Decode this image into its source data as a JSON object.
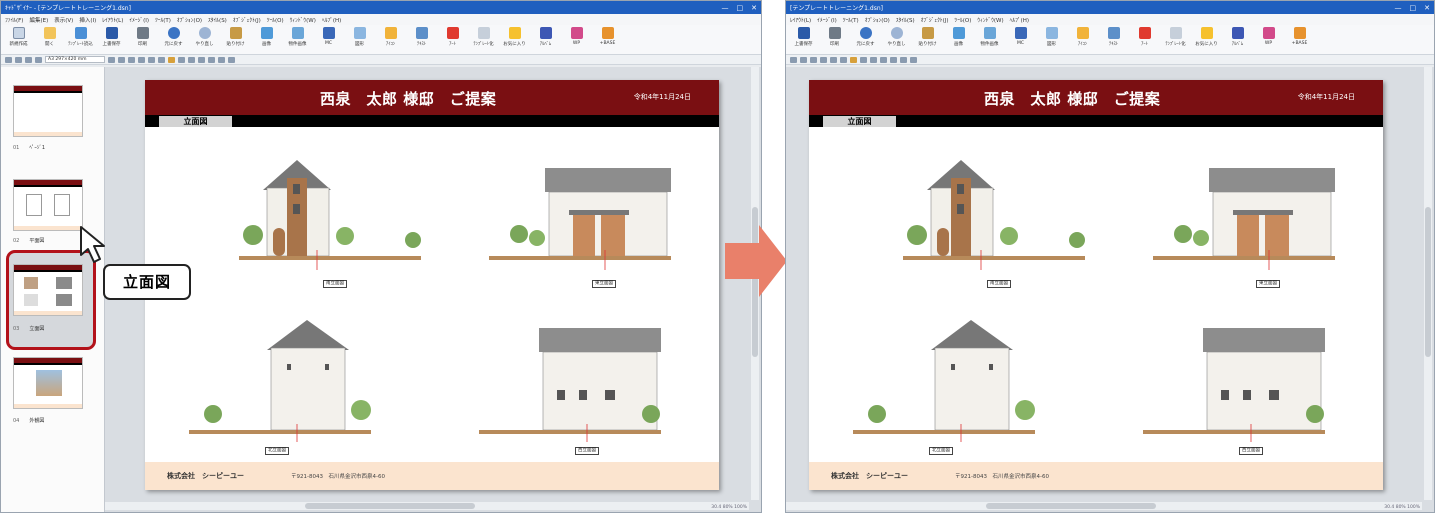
{
  "left_window": {
    "title": "ｷｬﾄﾞｻﾞｲﾅｰ - [テンプレートトレーニング1.dsn]",
    "window_controls": [
      "—",
      "□",
      "✕"
    ],
    "menu": [
      "ﾌｧｲﾙ(F)",
      "編集(E)",
      "表示(V)",
      "挿入(I)",
      "ﾚｲｱｳﾄ(L)",
      "ｲﾒｰｼﾞ(I)",
      "ﾂｰﾙ(T)",
      "ｵﾌﾟｼｮﾝ(O)",
      "ｽﾀｲﾙ(S)",
      "ｵﾌﾞｼﾞｪｸﾄ(J)",
      "ﾂｰﾙ(O)",
      "ｳｨﾝﾄﾞｳ(W)",
      "ﾍﾙﾌﾟ(H)"
    ],
    "ribbon": [
      "新規作成",
      "開く",
      "ﾃﾝﾌﾟﾚｰﾄ読込",
      "上書保存",
      "印刷",
      "元に戻す",
      "やり直し",
      "貼り付け",
      "画像",
      "物件画像",
      "MC",
      "図形",
      "ｱｲｺﾝ",
      "ﾃｷｽﾄ",
      "ｱｰﾄ",
      "ﾃﾝﾌﾟﾚｰﾄ化",
      "お気に入り",
      "ｱﾙﾊﾞﾑ",
      "WP",
      "+BASE"
    ],
    "paper_size": "A3 297×420 mm",
    "thumbnails": [
      {
        "num": "01",
        "label": "ﾍﾟｰｼﾞ1"
      },
      {
        "num": "02",
        "label": "平面図"
      },
      {
        "num": "03",
        "label": "立面図"
      },
      {
        "num": "04",
        "label": "外観図"
      }
    ],
    "callout": "立面図",
    "status": "30.4  80%  100%"
  },
  "right_window": {
    "title": "[テンプレートトレーニング1.dsn]",
    "window_controls": [
      "—",
      "□",
      "✕"
    ],
    "menu": [
      "ﾚｲｱｳﾄ(L)",
      "ｲﾒｰｼﾞ(I)",
      "ﾂｰﾙ(T)",
      "ｵﾌﾟｼｮﾝ(O)",
      "ｽﾀｲﾙ(S)",
      "ｵﾌﾞｼﾞｪｸﾄ(J)",
      "ﾂｰﾙ(O)",
      "ｳｨﾝﾄﾞｳ(W)",
      "ﾍﾙﾌﾟ(H)"
    ],
    "ribbon": [
      "上書保存",
      "印刷",
      "元に戻す",
      "やり直し",
      "貼り付け",
      "画像",
      "物件画像",
      "MC",
      "図形",
      "ｱｲｺﾝ",
      "ﾃｷｽﾄ",
      "ｱｰﾄ",
      "ﾃﾝﾌﾟﾚｰﾄ化",
      "お気に入り",
      "ｱﾙﾊﾞﾑ",
      "WP",
      "+BASE"
    ],
    "status": "30.4  80%  100%"
  },
  "page": {
    "title": "西泉　太郎 様邸　ご提案",
    "date": "令和4年11月24日",
    "section": "立面図",
    "elevations": [
      "南立面図",
      "東立面図",
      "北立面図",
      "西立面図"
    ],
    "company": "株式会社　シーピーユー",
    "address": "〒921-8043　石川県金沢市西泉4-60"
  },
  "colors": {
    "header": "#7a0f12",
    "footer": "#fbe4cf",
    "highlight": "#b3121a",
    "arrow": "#e9806a"
  }
}
